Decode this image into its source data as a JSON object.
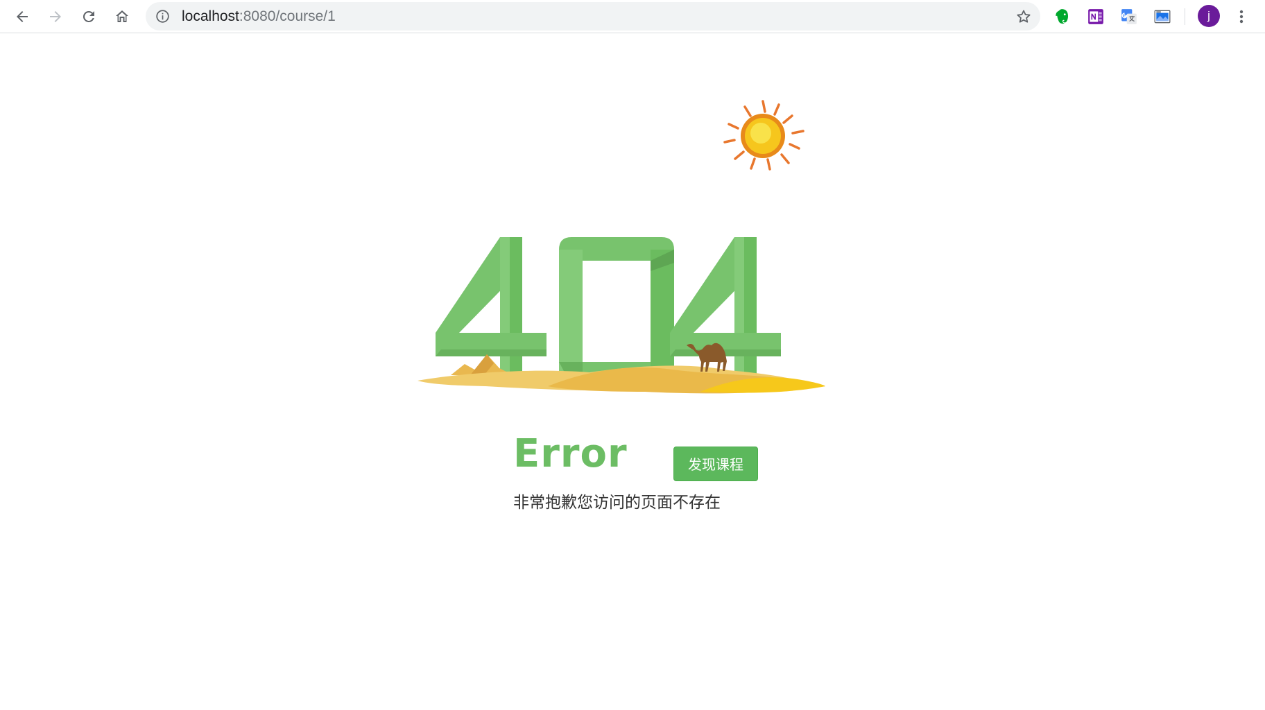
{
  "browser": {
    "url_host": "localhost",
    "url_path": ":8080/course/1",
    "avatar_letter": "j",
    "icons": {
      "back": "back-arrow-icon",
      "forward": "forward-arrow-icon",
      "reload": "reload-icon",
      "home": "home-icon",
      "info": "info-icon",
      "bookmark": "star-icon",
      "extensions": [
        "evernote-icon",
        "onenote-icon",
        "google-translate-icon",
        "screenshot-icon"
      ],
      "menu": "more-vertical-icon"
    }
  },
  "page": {
    "illustration": {
      "digits": "404",
      "digit_color": "#6cbd64",
      "sun_color": "#f5c518",
      "sand_color": "#f0c84a"
    },
    "error_title": "Error",
    "discover_button": "发现课程",
    "message": "非常抱歉您访问的页面不存在",
    "colors": {
      "accent": "#5cb85c",
      "title": "#6cbd64",
      "text": "#333333"
    }
  }
}
